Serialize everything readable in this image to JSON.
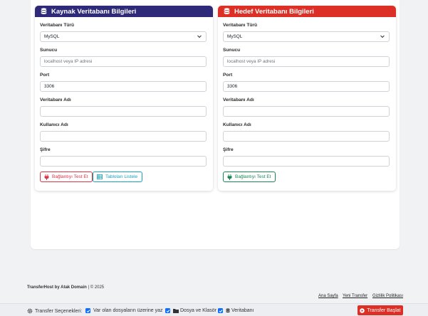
{
  "source": {
    "title": "Kaynak Veritabanı Bilgileri",
    "db_type_label": "Veritabanı Türü",
    "db_type_value": "MySQL",
    "host_label": "Sunucu",
    "host_placeholder": "localhost veya IP adresi",
    "port_label": "Port",
    "port_value": "3306",
    "dbname_label": "Veritabanı Adı",
    "user_label": "Kullanıcı Adı",
    "password_label": "Şifre",
    "test_button": "Bağlantıyı Test Et",
    "list_button": "Tabloları Listele"
  },
  "target": {
    "title": "Hedef Veritabanı Bilgileri",
    "db_type_label": "Veritabanı Türü",
    "db_type_value": "MySQL",
    "host_label": "Sunucu",
    "host_placeholder": "localhost veya IP adresi",
    "port_label": "Port",
    "port_value": "3306",
    "dbname_label": "Veritabanı Adı",
    "user_label": "Kullanıcı Adı",
    "password_label": "Şifre",
    "test_button": "Bağlantıyı Test Et"
  },
  "footer": {
    "brand": "TransferHost by Atak Domain",
    "copyright": "| © 2025",
    "links": [
      "Ana Sayfa",
      "Yeni Transfer",
      "Gizlilik Politikası"
    ]
  },
  "bottom_bar": {
    "options_label": "Transfer Seçenekleri:",
    "overwrite_label": "Var olan dosyaların üzerine yaz",
    "files_label": "Dosya ve Klasör",
    "database_label": "Veritabanı",
    "overwrite_checked": true,
    "files_checked": true,
    "database_checked": true,
    "start_button": "Transfer Başlat"
  },
  "colors": {
    "source_header": "#2e2a79",
    "target_header": "#dc2f26",
    "danger": "#dc3545",
    "info": "#17a2b8",
    "success": "#198754",
    "checkbox": "#0d6efd"
  },
  "icons": {
    "db": "database-icon",
    "plug": "plug-icon",
    "table": "table-icon",
    "gear": "gear-icon",
    "folder": "folder-icon",
    "play": "play-icon",
    "chevron": "chevron-down-icon"
  }
}
